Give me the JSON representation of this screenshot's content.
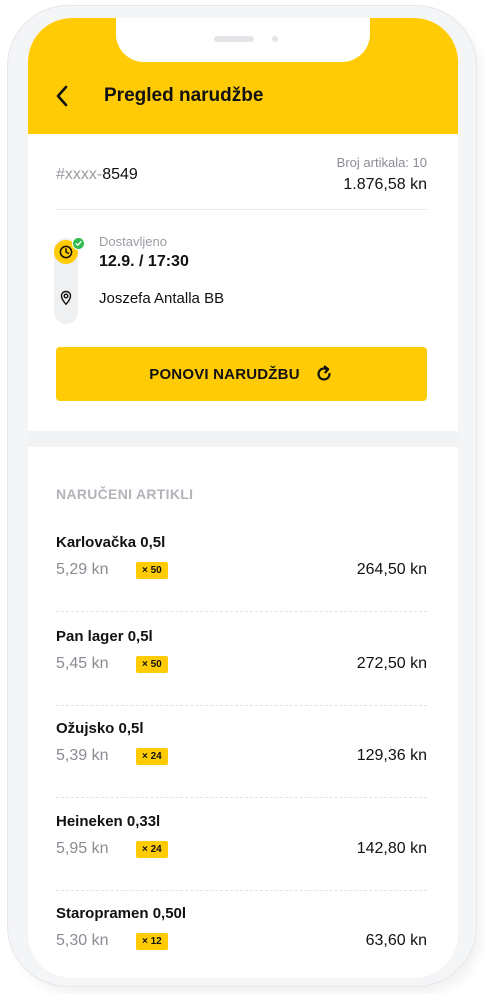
{
  "header": {
    "title": "Pregled narudžbe"
  },
  "order": {
    "id_prefix": "#xxxx-",
    "id_number": "8549",
    "item_count_label": "Broj artikala: 10",
    "total": "1.876,58 kn"
  },
  "delivery": {
    "status": "Dostavljeno",
    "datetime": "12.9. / 17:30",
    "address": "Joszefa Antalla BB"
  },
  "actions": {
    "reorder_label": "PONOVI NARUDŽBU"
  },
  "items_section": {
    "title": "NARUČENI ARTIKLI",
    "items": [
      {
        "name": "Karlovačka 0,5l",
        "unit_price": "5,29 kn",
        "quantity": "× 50",
        "total": "264,50 kn"
      },
      {
        "name": "Pan lager 0,5l",
        "unit_price": "5,45 kn",
        "quantity": "× 50",
        "total": "272,50 kn"
      },
      {
        "name": "Ožujsko 0,5l",
        "unit_price": "5,39 kn",
        "quantity": "× 24",
        "total": "129,36 kn"
      },
      {
        "name": "Heineken 0,33l",
        "unit_price": "5,95 kn",
        "quantity": "× 24",
        "total": "142,80 kn"
      },
      {
        "name": "Staropramen 0,50l",
        "unit_price": "5,30 kn",
        "quantity": "× 12",
        "total": "63,60 kn"
      }
    ]
  },
  "colors": {
    "accent": "#ffcb05",
    "success": "#2dbb4e",
    "muted_text": "#9a9ca3"
  },
  "icons": {
    "back": "chevron-left-icon",
    "clock": "clock-icon",
    "check": "check-icon",
    "pin": "location-pin-icon",
    "refresh": "refresh-icon"
  }
}
